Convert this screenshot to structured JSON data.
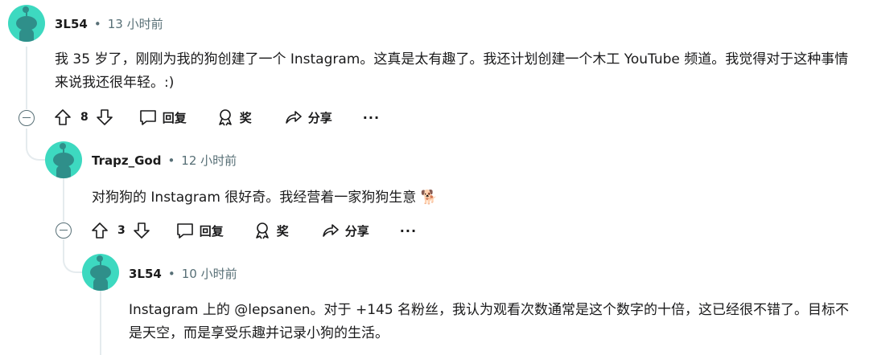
{
  "comments": [
    {
      "username": "3L54",
      "dot": "•",
      "time": "13 小时前",
      "text": "我 35 岁了，刚刚为我的狗创建了一个 Instagram。这真是太有趣了。我还计划创建一个木工 YouTube 频道。我觉得对于这种事情来说我还很年轻。:)",
      "votes": "8",
      "reply_label": "回复",
      "award_label": "奖",
      "share_label": "分享",
      "more_label": "···"
    },
    {
      "username": "Trapz_God",
      "dot": "•",
      "time": "12 小时前",
      "text": "对狗狗的 Instagram 很好奇。我经营着一家狗狗生意 🐕",
      "votes": "3",
      "reply_label": "回复",
      "award_label": "奖",
      "share_label": "分享",
      "more_label": "···"
    },
    {
      "username": "3L54",
      "dot": "•",
      "time": "10 小时前",
      "text": "Instagram 上的 @lepsanen。对于 +145 名粉丝，我认为观看次数通常是这个数字的十倍，这已经很不错了。目标不是天空，而是享受乐趣并记录小狗的生活。"
    }
  ],
  "icons": {
    "upvote": "arrow-up-icon",
    "downvote": "arrow-down-icon",
    "reply": "speech-bubble-icon",
    "award": "award-ribbon-icon",
    "share": "share-arrow-icon",
    "collapse": "minus-circle-icon"
  },
  "colors": {
    "avatar": "#3dd9c0",
    "meta_text": "#576f76",
    "thread_line": "#e5ebee"
  }
}
